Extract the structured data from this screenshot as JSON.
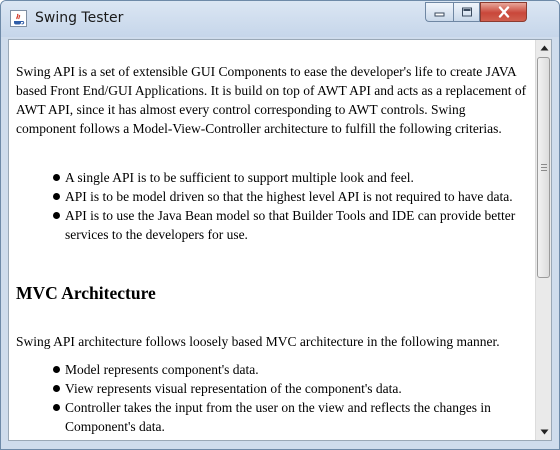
{
  "window": {
    "title": "Swing Tester",
    "icon": "java-cup-icon",
    "controls": [
      "minimize-icon",
      "maximize-icon",
      "close-icon"
    ]
  },
  "content": {
    "intro": "Swing API is a set of extensible GUI Components to ease the developer's life to create JAVA based Front End/GUI Applications. It is build on top of AWT API and acts as a replacement of AWT API, since it has almost every control corresponding to AWT controls. Swing component follows a Model-View-Controller architecture to fulfill the following criterias.",
    "criteria": [
      "A single API is to be sufficient to support multiple look and feel.",
      "API is to be model driven so that the highest level API is not required to have data.",
      "API is to use the Java Bean model so that Builder Tools and IDE can provide better services to the developers for use."
    ],
    "mvc_heading": "MVC Architecture",
    "mvc_intro": "Swing API architecture follows loosely based MVC architecture in the following manner.",
    "mvc_points": [
      "Model represents component's data.",
      "View represents visual representation of the component's data.",
      "Controller takes the input from the user on the view and reflects the changes in Component's data."
    ]
  },
  "scrollbar": {
    "position_fraction": 0.0,
    "visible_fraction": 0.6
  }
}
